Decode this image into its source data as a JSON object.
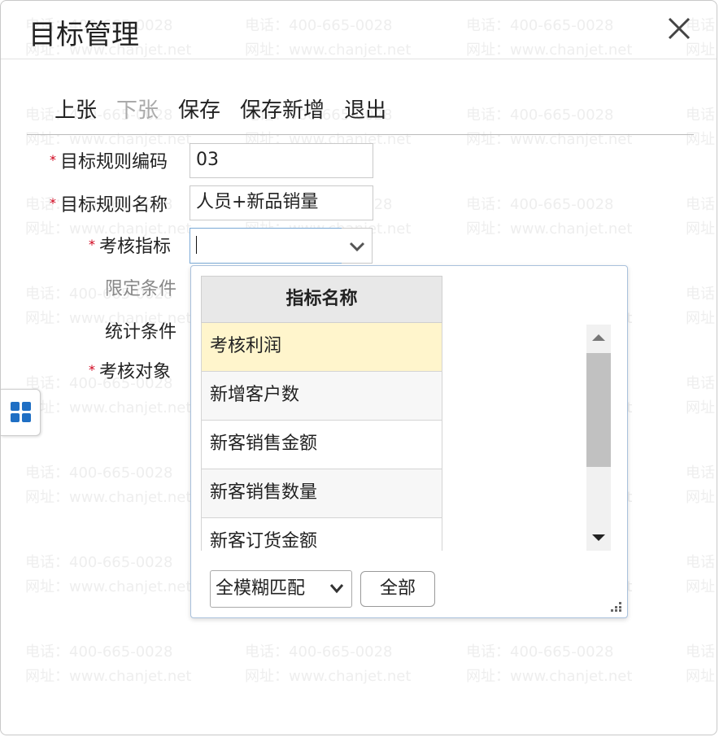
{
  "dialog": {
    "title": "目标管理"
  },
  "watermark": {
    "phone": "电话：400-665-0028",
    "site": "网址：www.chanjet.net"
  },
  "toolbar": {
    "prev": "上张",
    "next": "下张",
    "save": "保存",
    "save_new": "保存新增",
    "exit": "退出"
  },
  "form": {
    "code_label": "目标规则编码",
    "code_value": "03",
    "name_label": "目标规则名称",
    "name_value": "人员+新品销量",
    "metric_label": "考核指标",
    "metric_value": "",
    "limit_label": "限定条件",
    "stat_label": "统计条件",
    "target_label": "考核对象",
    "required_mark": "*"
  },
  "dropdown": {
    "column_header": "指标名称",
    "items": [
      "考核利润",
      "新增客户数",
      "新客销售金额",
      "新客销售数量",
      "新客订货金额"
    ],
    "selected_index": 0,
    "match_mode": "全模糊匹配",
    "all_button": "全部"
  },
  "colors": {
    "required": "#d0021b",
    "selected_row": "#fff5cc",
    "popup_border": "#a9c1dc",
    "side_icon": "#1f6fc4"
  }
}
